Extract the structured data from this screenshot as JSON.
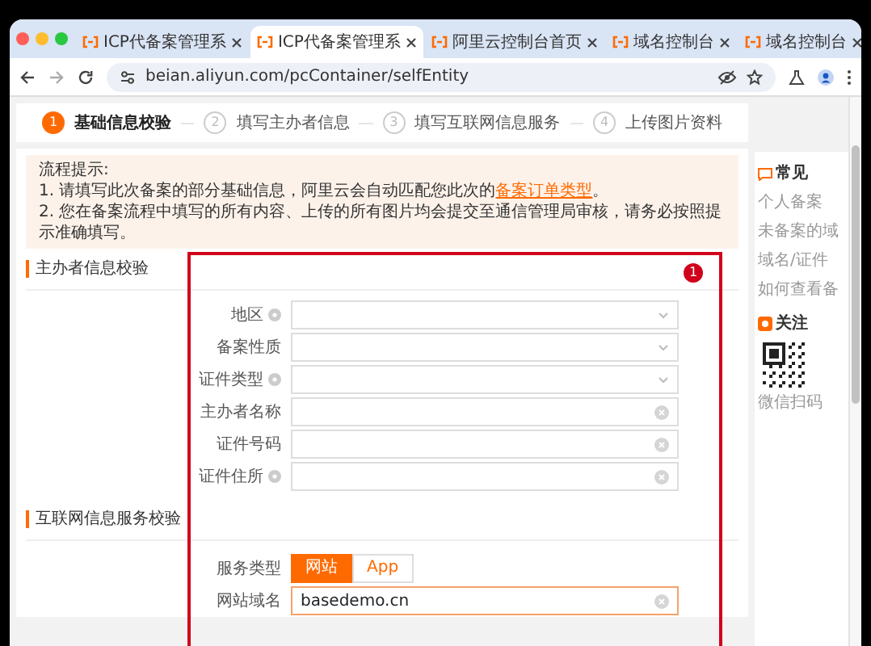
{
  "browser": {
    "tabs": [
      {
        "title": "ICP代备案管理系",
        "selected": false
      },
      {
        "title": "ICP代备案管理系",
        "selected": true
      },
      {
        "title": "阿里云控制台首页",
        "selected": false
      },
      {
        "title": "域名控制台",
        "selected": false
      },
      {
        "title": "域名控制台",
        "selected": false
      }
    ],
    "url": "beian.aliyun.com/pcContainer/selfEntity"
  },
  "steps": [
    {
      "number": "1",
      "label": "基础信息校验",
      "selected": true
    },
    {
      "number": "2",
      "label": "填写主办者信息",
      "selected": false
    },
    {
      "number": "3",
      "label": "填写互联网信息服务",
      "selected": false
    },
    {
      "number": "4",
      "label": "上传图片资料",
      "selected": false
    }
  ],
  "notice": {
    "title": "流程提示:",
    "line_1": {
      "text_before": "1. 请填写此次备案的部分基础信息，阿里云会自动匹配您此次的",
      "link": "备案订单类型",
      "text_after": "。"
    },
    "line_2": "2. 您在备案流程中填写的所有内容、上传的所有图片均会提交至通信管理局审核，请务必按照提示准确填写。"
  },
  "sections": [
    {
      "title": "主办者信息校验",
      "fields": [
        {
          "label": "地区",
          "help": true,
          "kind": "select"
        },
        {
          "label": "备案性质",
          "help": false,
          "kind": "select"
        },
        {
          "label": "证件类型",
          "help": true,
          "kind": "select"
        },
        {
          "label": "主办者名称",
          "help": false,
          "kind": "text"
        },
        {
          "label": "证件号码",
          "help": false,
          "kind": "text"
        },
        {
          "label": "证件住所",
          "help": true,
          "kind": "text"
        }
      ]
    },
    {
      "title": "互联网信息服务校验",
      "fields": [
        {
          "label": "服务类型",
          "help": false,
          "kind": "toggle",
          "options": [
            {
              "label": "网站",
              "selected": true
            },
            {
              "label": "App",
              "selected": false
            }
          ]
        },
        {
          "label": "网站域名",
          "help": false,
          "kind": "text",
          "value": "basedemo.cn"
        }
      ]
    }
  ],
  "sidebar": {
    "title": "常见",
    "links": [
      "个人备案",
      "未备案的域",
      "域名/证件",
      "如何查看备"
    ],
    "follow_title": "关注",
    "qr_caption": "微信扫码"
  },
  "annotation": {
    "badge": "1"
  }
}
